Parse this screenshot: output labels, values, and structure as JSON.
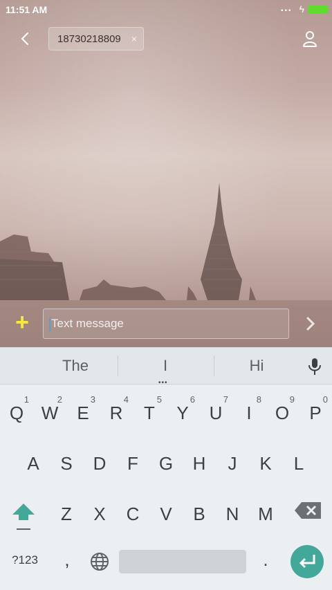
{
  "status": {
    "time": "11:51 AM",
    "signal_dots": "...",
    "charge": "ϟ"
  },
  "header": {
    "recipient": "18730218809",
    "chip_close": "×"
  },
  "compose": {
    "placeholder": "Text message",
    "plus_glyph": "+"
  },
  "keyboard": {
    "suggestions": [
      "The",
      "I",
      "Hi"
    ],
    "suggestion_more": "•••",
    "row1": [
      {
        "letter": "Q",
        "num": "1"
      },
      {
        "letter": "W",
        "num": "2"
      },
      {
        "letter": "E",
        "num": "3"
      },
      {
        "letter": "R",
        "num": "4"
      },
      {
        "letter": "T",
        "num": "5"
      },
      {
        "letter": "Y",
        "num": "6"
      },
      {
        "letter": "U",
        "num": "7"
      },
      {
        "letter": "I",
        "num": "8"
      },
      {
        "letter": "O",
        "num": "9"
      },
      {
        "letter": "P",
        "num": "0"
      }
    ],
    "row2": [
      "A",
      "S",
      "D",
      "F",
      "G",
      "H",
      "J",
      "K",
      "L"
    ],
    "row3": [
      "Z",
      "X",
      "C",
      "V",
      "B",
      "N",
      "M"
    ],
    "mode_label": "?123",
    "comma": ",",
    "period": "."
  },
  "colors": {
    "accent": "#41a89a",
    "battery": "#5fdc2c",
    "plus": "#f7ea3a"
  },
  "icons": [
    "back-arrow-icon",
    "person-icon",
    "chevron-right-icon",
    "microphone-icon",
    "shift-icon",
    "backspace-icon",
    "globe-icon",
    "enter-icon"
  ]
}
